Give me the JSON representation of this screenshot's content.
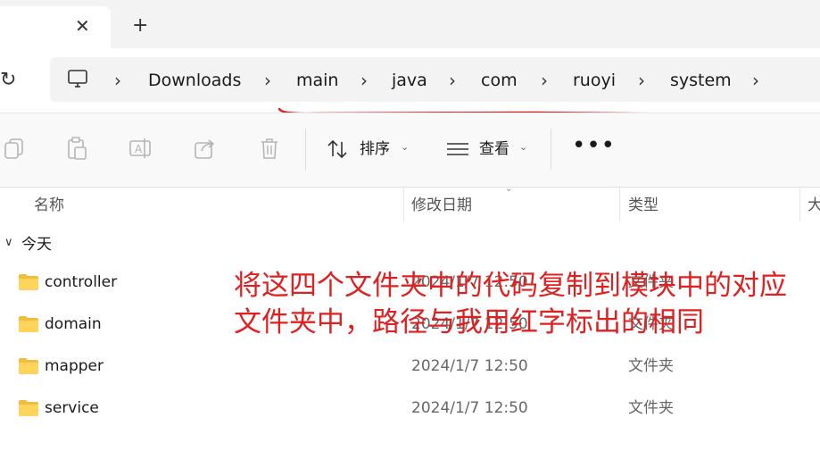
{
  "tabbar": {
    "close_glyph": "✕",
    "new_tab_glyph": "+"
  },
  "addressbar": {
    "refresh_glyph": "↻",
    "computer_icon": "monitor-icon",
    "crumbs": [
      "Downloads",
      "main",
      "java",
      "com",
      "ruoyi",
      "system"
    ],
    "separator": "›",
    "underline_color": "#e02020"
  },
  "commandbar": {
    "icons": [
      "copy-icon",
      "paste-icon",
      "rename-icon",
      "share-icon",
      "delete-icon"
    ],
    "sort_label": "排序",
    "view_label": "查看",
    "more_label": "•••"
  },
  "columns": {
    "name": "名称",
    "date": "修改日期",
    "type": "类型",
    "size": "大"
  },
  "group": {
    "toggle_glyph": "∨",
    "label": "今天"
  },
  "files": [
    {
      "name": "controller",
      "date": "2024/1/7 12:50",
      "type": "文件夹"
    },
    {
      "name": "domain",
      "date": "2024/1/7 12:50",
      "type": "文件夹"
    },
    {
      "name": "mapper",
      "date": "2024/1/7 12:50",
      "type": "文件夹"
    },
    {
      "name": "service",
      "date": "2024/1/7 12:50",
      "type": "文件夹"
    }
  ],
  "annotation": {
    "line1": "将这四个文件夹中的代码复制到模块中的对应",
    "line2": "文件夹中，路径与我用红字标出的相同",
    "color": "#e02020"
  }
}
